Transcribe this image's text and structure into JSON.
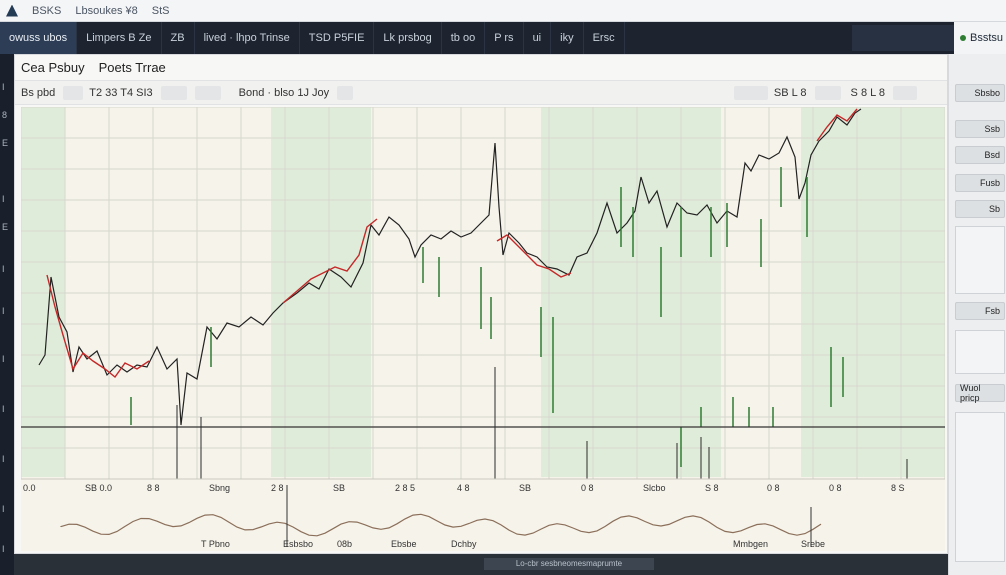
{
  "topbar": {
    "item1": "BSKS",
    "item2": "Lbsoukes ¥8",
    "item3": "StS"
  },
  "nav": {
    "tabs": [
      "owuss ubos",
      "Limpers  B  Ze",
      "ZB",
      "lived · lhpo Trinse",
      "TSD  P5FIE",
      "Lk  prsbog",
      "tb  oo",
      "P  rs",
      "ui",
      "iky",
      "Ersc"
    ],
    "brand": "Bsstsu"
  },
  "panel": {
    "title": "Cea Psbuy",
    "subtitle": "Poets Trrae",
    "toolbar": {
      "left": "Bs pbd",
      "range": "T2 33 T4 SI3",
      "symbol": "Bond · blso 1J Joy",
      "right1": "SB L 8",
      "right2": "S 8 L 8"
    },
    "xaxis_top": [
      "0.0",
      "SB  0.0",
      "8  8",
      "Sbng",
      "2  8",
      "SB",
      "2  8  5",
      "4 8",
      "SB",
      "0  8",
      "Slcbo",
      "S  8",
      "0  8",
      "0  8",
      "8 S"
    ],
    "xaxis_bottom": [
      "T  Pbno",
      "Esbsbo",
      "08b",
      "Ebsbe",
      "Dchby",
      "Mmbgen",
      "Srebe"
    ],
    "footer": "Lo-cbr  sesbneomesmaprumte"
  },
  "rail": {
    "labels": [
      "I",
      "8",
      "E",
      "I",
      "E",
      "I",
      "I",
      "I",
      "I",
      "I",
      "I",
      "I"
    ]
  },
  "sidebar": {
    "buttons": [
      "Sbsbo",
      "Ssb",
      "Bsd",
      "Fusb",
      "Sb",
      "Fsb",
      "Wuol  pricp"
    ]
  },
  "colors": {
    "up": "#2e7d32",
    "down": "#c62828",
    "line": "#222222",
    "grid": "#d7d7cf",
    "greenFill": "#d8ead4"
  }
}
